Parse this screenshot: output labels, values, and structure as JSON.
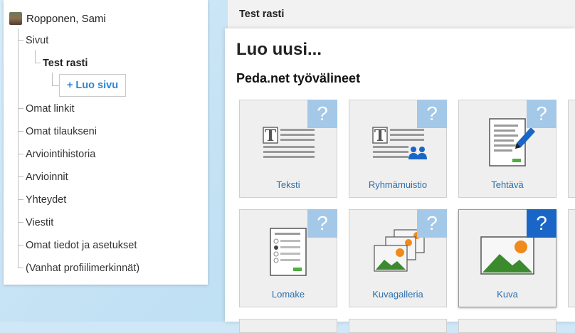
{
  "tree": {
    "user_name": "Ropponen, Sami",
    "items": [
      {
        "label": "Sivut"
      },
      {
        "label": "Test rasti"
      },
      {
        "label": "Omat linkit"
      },
      {
        "label": "Omat tilaukseni"
      },
      {
        "label": "Arviointihistoria"
      },
      {
        "label": "Arvioinnit"
      },
      {
        "label": "Yhteydet"
      },
      {
        "label": "Viestit"
      },
      {
        "label": "Omat tiedot ja asetukset"
      },
      {
        "label": "(Vanhat profiilimerkinnät)"
      }
    ],
    "add_page_label": "+ Luo sivu"
  },
  "main": {
    "breadcrumb_title": "Test rasti",
    "create_title": "Luo uusi...",
    "section_title": "Peda.net työvälineet",
    "help_glyph": "?",
    "tiles": [
      {
        "label": "Teksti",
        "icon": "text-icon"
      },
      {
        "label": "Ryhmämuistio",
        "icon": "group-memo-icon"
      },
      {
        "label": "Tehtävä",
        "icon": "task-icon"
      },
      {
        "label": "Lomake",
        "icon": "form-icon"
      },
      {
        "label": "Kuvagalleria",
        "icon": "gallery-icon"
      },
      {
        "label": "Kuva",
        "icon": "image-icon"
      }
    ]
  },
  "colors": {
    "link": "#2b86d4",
    "help_badge": "#a4c8e8",
    "help_badge_active": "#1a66c6",
    "accent_green": "#4caf3f",
    "accent_orange": "#f08a1c"
  }
}
